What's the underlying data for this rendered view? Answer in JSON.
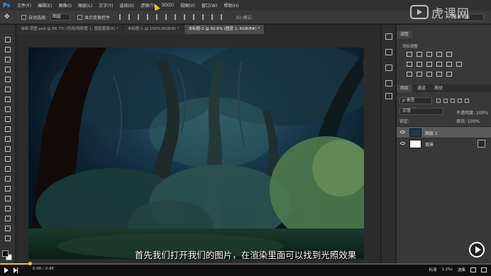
{
  "app": {
    "logo": "Ps"
  },
  "menu": [
    "文件(F)",
    "编辑(E)",
    "图像(I)",
    "图层(L)",
    "文字(Y)",
    "选择(S)",
    "滤镜(T)",
    "3D(D)",
    "视图(V)",
    "窗口(W)",
    "帮助(H)"
  ],
  "options": {
    "auto_select_label": "自动选择:",
    "auto_select_value": "图层",
    "transform_label": "显示变换控件",
    "mode_3d_label": "3D 模式:",
    "workspace": "基本功能"
  },
  "watermark": {
    "text": "虎课网"
  },
  "tabs": [
    {
      "label": "油画 草图.psd @ 66.7% (色相/饱和度 1, 图层蒙版/8) *",
      "active": false
    },
    {
      "label": "未标题-1 @ 100%(RGB/8) *",
      "active": false
    },
    {
      "label": "未标题-2 @ 82.6% (图层 1, RGB/8#) *",
      "active": true
    }
  ],
  "panels": {
    "adjust_tab": "调整",
    "adjust_add_label": "添加调整",
    "layers_tabs": [
      "图层",
      "通道",
      "路径"
    ],
    "filter_label": "ρ 类型",
    "blend_mode": "正常",
    "opacity_label": "不透明度: 100%",
    "lock_label": "锁定:",
    "fill_label": "填充: 100%",
    "layers": [
      {
        "name": "图层 1",
        "active": true
      },
      {
        "name": "背景",
        "active": false
      }
    ]
  },
  "subtitle": "首先我们打开我们的图片，在渲染里面可以找到光照效果",
  "video": {
    "time": "0:00 / 2:45",
    "progress": 0.06,
    "right": [
      "标清",
      "1.25x",
      "选集"
    ]
  },
  "colors": {
    "accent": "#f5c518",
    "ps_blue": "#31a8ff",
    "panel": "#383838",
    "canvas_bg": "#0b1d2c"
  }
}
